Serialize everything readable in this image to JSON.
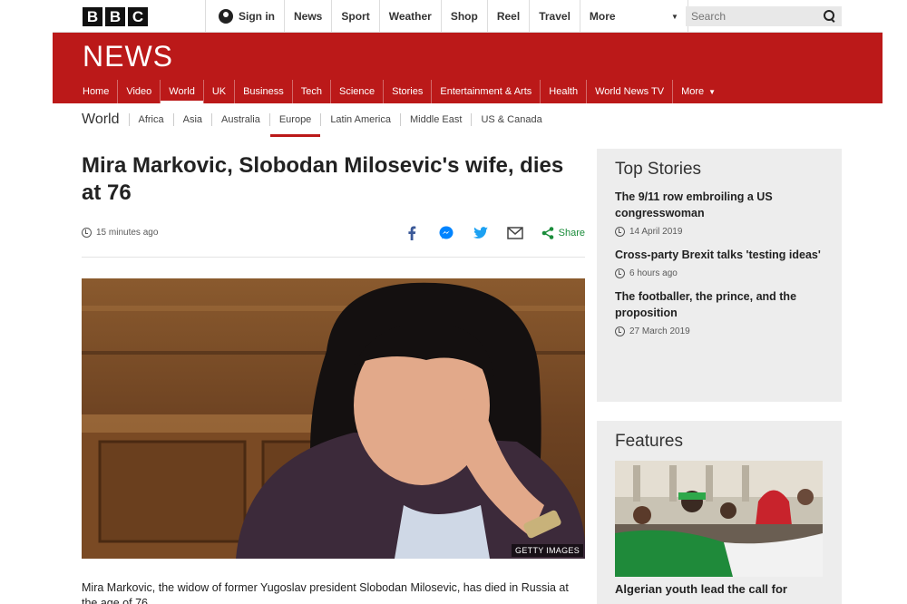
{
  "masthead": {
    "logo_letters": [
      "B",
      "B",
      "C"
    ],
    "signin_label": "Sign in",
    "nav": [
      "News",
      "Sport",
      "Weather",
      "Shop",
      "Reel",
      "Travel"
    ],
    "more_label": "More",
    "search_placeholder": "Search"
  },
  "newsband": {
    "logo": "NEWS",
    "nav": [
      {
        "label": "Home",
        "active": false
      },
      {
        "label": "Video",
        "active": false
      },
      {
        "label": "World",
        "active": true
      },
      {
        "label": "UK",
        "active": false
      },
      {
        "label": "Business",
        "active": false
      },
      {
        "label": "Tech",
        "active": false
      },
      {
        "label": "Science",
        "active": false
      },
      {
        "label": "Stories",
        "active": false
      },
      {
        "label": "Entertainment & Arts",
        "active": false
      },
      {
        "label": "Health",
        "active": false
      },
      {
        "label": "World News TV",
        "active": false
      }
    ],
    "more_label": "More"
  },
  "subnav": {
    "section": "World",
    "items": [
      {
        "label": "Africa",
        "active": false
      },
      {
        "label": "Asia",
        "active": false
      },
      {
        "label": "Australia",
        "active": false
      },
      {
        "label": "Europe",
        "active": true
      },
      {
        "label": "Latin America",
        "active": false
      },
      {
        "label": "Middle East",
        "active": false
      },
      {
        "label": "US & Canada",
        "active": false
      }
    ]
  },
  "article": {
    "headline": "Mira Markovic, Slobodan Milosevic's wife, dies at 76",
    "timestamp": "15 minutes ago",
    "share_label": "Share",
    "image_credit": "GETTY IMAGES",
    "lede": "Mira Markovic, the widow of former Yugoslav president Slobodan Milosevic, has died in Russia at the age of 76."
  },
  "top_stories": {
    "title": "Top Stories",
    "items": [
      {
        "title": "The 9/11 row embroiling a US congresswoman",
        "time": "14 April 2019"
      },
      {
        "title": "Cross-party Brexit talks 'testing ideas'",
        "time": "6 hours ago"
      },
      {
        "title": "The footballer, the prince, and the proposition",
        "time": "27 March 2019"
      }
    ]
  },
  "features": {
    "title": "Features",
    "items": [
      {
        "title": "Algerian youth lead the call for"
      }
    ]
  },
  "colors": {
    "brand_red": "#bb1919",
    "share_green": "#1a8c3a",
    "facebook": "#3b5998",
    "messenger": "#0084ff",
    "twitter": "#1da1f2"
  }
}
